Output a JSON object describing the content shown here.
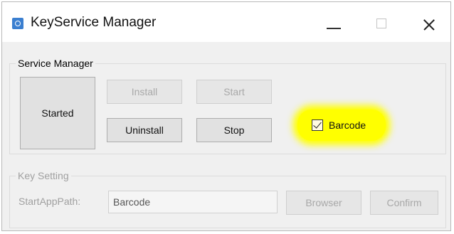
{
  "window": {
    "title": "KeyService Manager"
  },
  "service_manager": {
    "legend": "Service Manager",
    "started_label": "Started",
    "install_label": "Install",
    "start_label": "Start",
    "uninstall_label": "Uninstall",
    "stop_label": "Stop",
    "barcode_checkbox": {
      "label": "Barcode",
      "checked": true
    }
  },
  "key_setting": {
    "legend": "Key Setting",
    "start_app_path_label": "StartAppPath:",
    "start_app_path_value": "Barcode",
    "browser_label": "Browser",
    "confirm_label": "Confirm"
  },
  "colors": {
    "highlight": "#ffff00",
    "app_icon": "#3b7fd0"
  },
  "icons": [
    "app-icon",
    "minimize-icon",
    "maximize-icon",
    "close-icon",
    "checkmark-icon"
  ]
}
